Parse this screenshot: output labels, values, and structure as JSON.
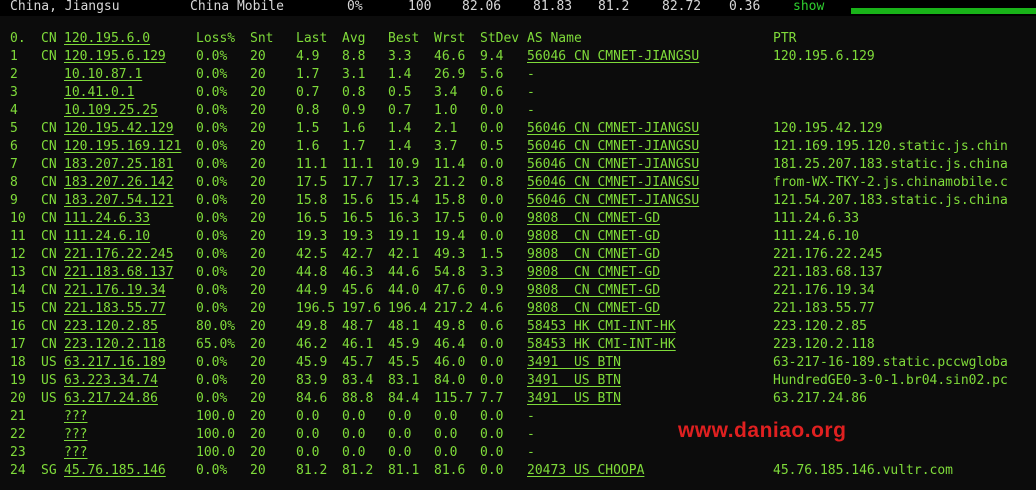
{
  "summary": {
    "location": "China, Jiangsu",
    "isp": "China Mobile",
    "loss": "0%",
    "sent": "100",
    "last": "82.06",
    "avg": "81.83",
    "best": "81.2",
    "worst": "82.72",
    "stdev": "0.36",
    "show_label": "show"
  },
  "headers": {
    "hop": "0.",
    "cc": "CN",
    "host": "120.195.6.0",
    "loss": "Loss%",
    "snt": "Snt",
    "last": "Last",
    "avg": "Avg",
    "best": "Best",
    "wrst": "Wrst",
    "stdev": "StDev",
    "as": "AS Name",
    "ptr": "PTR"
  },
  "hops": [
    {
      "n": "1",
      "cc": "CN",
      "host": "120.195.6.129",
      "loss": "0.0%",
      "snt": "20",
      "last": "4.9",
      "avg": "8.8",
      "best": "3.3",
      "wrst": "46.6",
      "stdev": "9.4",
      "as": "56046 CN CMNET-JIANGSU",
      "ptr": "120.195.6.129"
    },
    {
      "n": "2",
      "cc": "",
      "host": "10.10.87.1",
      "loss": "0.0%",
      "snt": "20",
      "last": "1.7",
      "avg": "3.1",
      "best": "1.4",
      "wrst": "26.9",
      "stdev": "5.6",
      "as": "-",
      "ptr": ""
    },
    {
      "n": "3",
      "cc": "",
      "host": "10.41.0.1",
      "loss": "0.0%",
      "snt": "20",
      "last": "0.7",
      "avg": "0.8",
      "best": "0.5",
      "wrst": "3.4",
      "stdev": "0.6",
      "as": "-",
      "ptr": ""
    },
    {
      "n": "4",
      "cc": "",
      "host": "10.109.25.25",
      "loss": "0.0%",
      "snt": "20",
      "last": "0.8",
      "avg": "0.9",
      "best": "0.7",
      "wrst": "1.0",
      "stdev": "0.0",
      "as": "-",
      "ptr": ""
    },
    {
      "n": "5",
      "cc": "CN",
      "host": "120.195.42.129",
      "loss": "0.0%",
      "snt": "20",
      "last": "1.5",
      "avg": "1.6",
      "best": "1.4",
      "wrst": "2.1",
      "stdev": "0.0",
      "as": "56046 CN CMNET-JIANGSU",
      "ptr": "120.195.42.129"
    },
    {
      "n": "6",
      "cc": "CN",
      "host": "120.195.169.121",
      "loss": "0.0%",
      "snt": "20",
      "last": "1.6",
      "avg": "1.7",
      "best": "1.4",
      "wrst": "3.7",
      "stdev": "0.5",
      "as": "56046 CN CMNET-JIANGSU",
      "ptr": "121.169.195.120.static.js.chin"
    },
    {
      "n": "7",
      "cc": "CN",
      "host": "183.207.25.181",
      "loss": "0.0%",
      "snt": "20",
      "last": "11.1",
      "avg": "11.1",
      "best": "10.9",
      "wrst": "11.4",
      "stdev": "0.0",
      "as": "56046 CN CMNET-JIANGSU",
      "ptr": "181.25.207.183.static.js.china"
    },
    {
      "n": "8",
      "cc": "CN",
      "host": "183.207.26.142",
      "loss": "0.0%",
      "snt": "20",
      "last": "17.5",
      "avg": "17.7",
      "best": "17.3",
      "wrst": "21.2",
      "stdev": "0.8",
      "as": "56046 CN CMNET-JIANGSU",
      "ptr": "from-WX-TKY-2.js.chinamobile.c"
    },
    {
      "n": "9",
      "cc": "CN",
      "host": "183.207.54.121",
      "loss": "0.0%",
      "snt": "20",
      "last": "15.8",
      "avg": "15.6",
      "best": "15.4",
      "wrst": "15.8",
      "stdev": "0.0",
      "as": "56046 CN CMNET-JIANGSU",
      "ptr": "121.54.207.183.static.js.china"
    },
    {
      "n": "10",
      "cc": "CN",
      "host": "111.24.6.33",
      "loss": "0.0%",
      "snt": "20",
      "last": "16.5",
      "avg": "16.5",
      "best": "16.3",
      "wrst": "17.5",
      "stdev": "0.0",
      "as": "9808  CN CMNET-GD",
      "ptr": "111.24.6.33"
    },
    {
      "n": "11",
      "cc": "CN",
      "host": "111.24.6.10",
      "loss": "0.0%",
      "snt": "20",
      "last": "19.3",
      "avg": "19.3",
      "best": "19.1",
      "wrst": "19.4",
      "stdev": "0.0",
      "as": "9808  CN CMNET-GD",
      "ptr": "111.24.6.10"
    },
    {
      "n": "12",
      "cc": "CN",
      "host": "221.176.22.245",
      "loss": "0.0%",
      "snt": "20",
      "last": "42.5",
      "avg": "42.7",
      "best": "42.1",
      "wrst": "49.3",
      "stdev": "1.5",
      "as": "9808  CN CMNET-GD",
      "ptr": "221.176.22.245"
    },
    {
      "n": "13",
      "cc": "CN",
      "host": "221.183.68.137",
      "loss": "0.0%",
      "snt": "20",
      "last": "44.8",
      "avg": "46.3",
      "best": "44.6",
      "wrst": "54.8",
      "stdev": "3.3",
      "as": "9808  CN CMNET-GD",
      "ptr": "221.183.68.137"
    },
    {
      "n": "14",
      "cc": "CN",
      "host": "221.176.19.34",
      "loss": "0.0%",
      "snt": "20",
      "last": "44.9",
      "avg": "45.6",
      "best": "44.0",
      "wrst": "47.6",
      "stdev": "0.9",
      "as": "9808  CN CMNET-GD",
      "ptr": "221.176.19.34"
    },
    {
      "n": "15",
      "cc": "CN",
      "host": "221.183.55.77",
      "loss": "0.0%",
      "snt": "20",
      "last": "196.5",
      "avg": "197.6",
      "best": "196.4",
      "wrst": "217.2",
      "stdev": "4.6",
      "as": "9808  CN CMNET-GD",
      "ptr": "221.183.55.77"
    },
    {
      "n": "16",
      "cc": "CN",
      "host": "223.120.2.85",
      "loss": "80.0%",
      "snt": "20",
      "last": "49.8",
      "avg": "48.7",
      "best": "48.1",
      "wrst": "49.8",
      "stdev": "0.6",
      "as": "58453 HK CMI-INT-HK",
      "ptr": "223.120.2.85"
    },
    {
      "n": "17",
      "cc": "CN",
      "host": "223.120.2.118",
      "loss": "65.0%",
      "snt": "20",
      "last": "46.2",
      "avg": "46.1",
      "best": "45.9",
      "wrst": "46.4",
      "stdev": "0.0",
      "as": "58453 HK CMI-INT-HK",
      "ptr": "223.120.2.118"
    },
    {
      "n": "18",
      "cc": "US",
      "host": "63.217.16.189",
      "loss": "0.0%",
      "snt": "20",
      "last": "45.9",
      "avg": "45.7",
      "best": "45.5",
      "wrst": "46.0",
      "stdev": "0.0",
      "as": "3491  US BTN",
      "ptr": "63-217-16-189.static.pccwgloba"
    },
    {
      "n": "19",
      "cc": "US",
      "host": "63.223.34.74",
      "loss": "0.0%",
      "snt": "20",
      "last": "83.9",
      "avg": "83.4",
      "best": "83.1",
      "wrst": "84.0",
      "stdev": "0.0",
      "as": "3491  US BTN",
      "ptr": "HundredGE0-3-0-1.br04.sin02.pc"
    },
    {
      "n": "20",
      "cc": "US",
      "host": "63.217.24.86",
      "loss": "0.0%",
      "snt": "20",
      "last": "84.6",
      "avg": "88.8",
      "best": "84.4",
      "wrst": "115.7",
      "stdev": "7.7",
      "as": "3491  US BTN",
      "ptr": "63.217.24.86"
    },
    {
      "n": "21",
      "cc": "",
      "host": "???",
      "loss": "100.0",
      "snt": "20",
      "last": "0.0",
      "avg": "0.0",
      "best": "0.0",
      "wrst": "0.0",
      "stdev": "0.0",
      "as": "-",
      "ptr": ""
    },
    {
      "n": "22",
      "cc": "",
      "host": "???",
      "loss": "100.0",
      "snt": "20",
      "last": "0.0",
      "avg": "0.0",
      "best": "0.0",
      "wrst": "0.0",
      "stdev": "0.0",
      "as": "-",
      "ptr": ""
    },
    {
      "n": "23",
      "cc": "",
      "host": "???",
      "loss": "100.0",
      "snt": "20",
      "last": "0.0",
      "avg": "0.0",
      "best": "0.0",
      "wrst": "0.0",
      "stdev": "0.0",
      "as": "-",
      "ptr": ""
    },
    {
      "n": "24",
      "cc": "SG",
      "host": "45.76.185.146",
      "loss": "0.0%",
      "snt": "20",
      "last": "81.2",
      "avg": "81.2",
      "best": "81.1",
      "wrst": "81.6",
      "stdev": "0.0",
      "as": "20473 US CHOOPA",
      "ptr": "45.76.185.146.vultr.com"
    }
  ],
  "watermark": "www.daniao.org",
  "colors": {
    "background": "#0c0c0c",
    "text_green": "#7fdb3a",
    "show_green": "#2fcf2f",
    "bar_green": "#19b319",
    "watermark_red": "#e02020"
  }
}
